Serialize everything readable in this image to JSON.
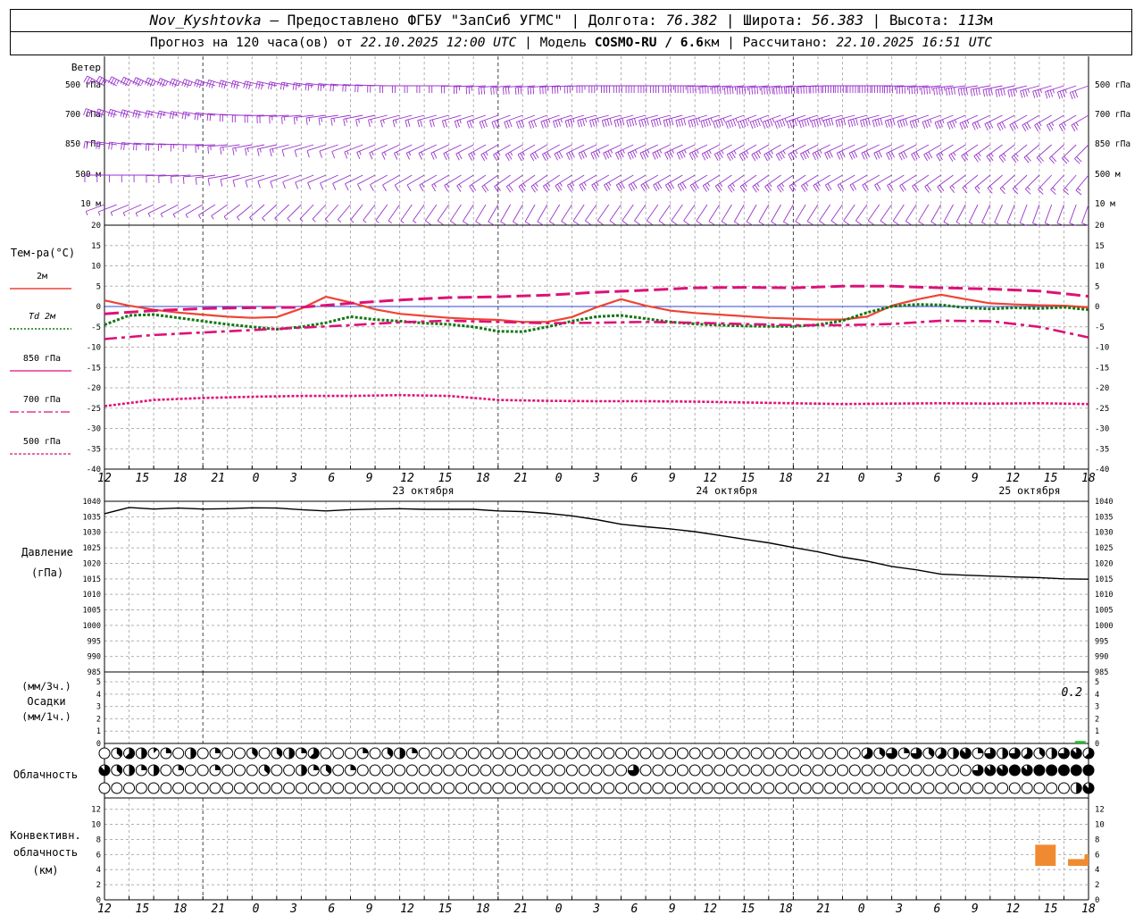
{
  "header": {
    "station": "Nov_Kyshtovka",
    "provider": "Предоставлено ФГБУ \"ЗапСиб УГМС\"",
    "lon_label": "Долгота:",
    "lon": "76.382",
    "lat_label": "Широта:",
    "lat": "56.383",
    "alt_label": "Высота:",
    "alt": "113",
    "alt_unit": "м",
    "forecast_label": "Прогноз на 120 часа(ов) от",
    "forecast_start": "22.10.2025 12:00 UTC",
    "model_label": "Модель",
    "model": "COSMO-RU / 6.6",
    "model_unit": "км",
    "calc_label": "Рассчитано:",
    "calc_time": "22.10.2025 16:51 UTC"
  },
  "colors": {
    "wind": "#9933cc",
    "temp2m": "#ee4433",
    "td2m": "#117711",
    "t850": "#dd1177",
    "t700": "#dd1177",
    "t500": "#dd1177",
    "pressure": "#000000",
    "precip": "#22bb33",
    "convective": "#f08a30",
    "grid": "#b0b0b0",
    "zero_line": "#3344cc"
  },
  "wind_panel": {
    "title": "Ветер",
    "levels": [
      "500 гПа",
      "700 гПа",
      "850 гПа",
      "500 м",
      "10  м"
    ]
  },
  "temp_panel": {
    "title": "Тем-ра(°C)",
    "legend": [
      "2м",
      "Td  2м",
      "850 гПа",
      "700 гПа",
      "500 гПа"
    ],
    "ticks": [
      "20",
      "15",
      "10",
      "5",
      "0",
      "-5",
      "-10",
      "-15",
      "-20",
      "-25",
      "-30",
      "-35",
      "-40"
    ]
  },
  "time_axis": {
    "hour_labels": [
      "12",
      "15",
      "18",
      "21",
      "0",
      "3",
      "6",
      "9",
      "12",
      "15",
      "18",
      "21",
      "0",
      "3",
      "6",
      "9",
      "12",
      "15",
      "18",
      "21",
      "0",
      "3",
      "6",
      "9",
      "12",
      "15",
      "18"
    ],
    "date_labels": [
      "23 октября",
      "24 октября",
      "25 октября"
    ]
  },
  "pressure_panel": {
    "title": "Давление",
    "unit": "(гПа)",
    "ticks": [
      "1040",
      "1035",
      "1030",
      "1025",
      "1020",
      "1015",
      "1010",
      "1005",
      "1000",
      "995",
      "990",
      "985"
    ]
  },
  "precip_panel": {
    "unit_top": "(мм/3ч.)",
    "title": "Осадки",
    "unit_bottom": "(мм/1ч.)",
    "ticks": [
      "5",
      "4",
      "3",
      "2",
      "1",
      "0"
    ],
    "annotation": "0.2"
  },
  "cloud_panel": {
    "title": "Облачность"
  },
  "conv_panel": {
    "title_1": "Конвективн.",
    "title_2": "облачность",
    "unit": "(км)",
    "ticks": [
      "12",
      "10",
      "8",
      "6",
      "4",
      "2",
      "0"
    ]
  },
  "chart_data": [
    {
      "type": "wind_barbs",
      "x_unit": "hours from 22.10.2025 12:00 UTC",
      "levels": [
        "500 гПа",
        "700 гПа",
        "850 гПа",
        "500 м",
        "10 м"
      ],
      "x": [
        0,
        6,
        12,
        18,
        24,
        30,
        36,
        42,
        48,
        54,
        60,
        66,
        72,
        78,
        84,
        90,
        96,
        102,
        108,
        114,
        120
      ],
      "direction_deg": [
        [
          300,
          295,
          290,
          285,
          280,
          275,
          270,
          270,
          265,
          265,
          270,
          270,
          270,
          265,
          265,
          270,
          270,
          265,
          260,
          255,
          250
        ],
        [
          290,
          285,
          280,
          270,
          265,
          260,
          255,
          255,
          250,
          250,
          255,
          255,
          255,
          250,
          250,
          255,
          255,
          250,
          245,
          240,
          240
        ],
        [
          280,
          275,
          270,
          260,
          255,
          250,
          245,
          245,
          240,
          240,
          245,
          245,
          245,
          240,
          240,
          245,
          245,
          240,
          235,
          230,
          225
        ],
        [
          270,
          270,
          265,
          255,
          250,
          245,
          240,
          240,
          235,
          235,
          240,
          240,
          240,
          235,
          235,
          240,
          240,
          235,
          230,
          225,
          220
        ],
        [
          250,
          245,
          240,
          230,
          225,
          220,
          215,
          215,
          210,
          210,
          215,
          215,
          215,
          210,
          210,
          215,
          215,
          210,
          205,
          200,
          200
        ]
      ],
      "speed_ms": [
        [
          18,
          18,
          17,
          15,
          13,
          11,
          9,
          10,
          14,
          16,
          18,
          20,
          22,
          23,
          24,
          25,
          24,
          22,
          20,
          18,
          16
        ],
        [
          14,
          14,
          12,
          10,
          8,
          7,
          8,
          10,
          14,
          16,
          18,
          20,
          21,
          22,
          22,
          21,
          20,
          18,
          16,
          14,
          12
        ],
        [
          9,
          9,
          8,
          7,
          6,
          6,
          7,
          9,
          12,
          14,
          16,
          17,
          18,
          18,
          17,
          16,
          15,
          14,
          12,
          11,
          10
        ],
        [
          6,
          6,
          5,
          5,
          4,
          4,
          5,
          7,
          10,
          12,
          13,
          14,
          14,
          13,
          12,
          11,
          10,
          9,
          8,
          7,
          8
        ],
        [
          3,
          3,
          3,
          3,
          2,
          2,
          3,
          4,
          5,
          6,
          6,
          6,
          6,
          5,
          5,
          5,
          4,
          4,
          3,
          4,
          5
        ]
      ]
    },
    {
      "type": "line",
      "title": "Тем-ра(°C)",
      "x_unit": "hours from 22.10.2025 12:00 UTC",
      "ylim": [
        -40,
        20
      ],
      "grid": true,
      "series": [
        {
          "name": "2м",
          "x": [
            0,
            3,
            6,
            9,
            12,
            15,
            18,
            21,
            24,
            27,
            30,
            33,
            36,
            39,
            42,
            45,
            48,
            51,
            54,
            57,
            60,
            63,
            66,
            69,
            72,
            75,
            78,
            81,
            84,
            87,
            90,
            93,
            96,
            99,
            102,
            105,
            108,
            111,
            114,
            117,
            120
          ],
          "y": [
            1.5,
            0.2,
            -0.8,
            -1.5,
            -2.0,
            -2.5,
            -2.8,
            -2.6,
            -0.5,
            2.4,
            1.0,
            -0.7,
            -1.8,
            -2.3,
            -2.8,
            -3.1,
            -3.3,
            -3.8,
            -3.8,
            -2.6,
            -0.2,
            1.8,
            0.2,
            -1.0,
            -1.6,
            -2.0,
            -2.4,
            -2.8,
            -3.0,
            -3.2,
            -3.2,
            -2.5,
            0.2,
            1.7,
            2.9,
            1.8,
            0.8,
            0.5,
            0.3,
            0.2,
            -0.2
          ]
        },
        {
          "name": "Td 2м",
          "x": [
            0,
            3,
            6,
            9,
            12,
            15,
            18,
            21,
            24,
            27,
            30,
            33,
            36,
            39,
            42,
            45,
            48,
            51,
            54,
            57,
            60,
            63,
            66,
            69,
            72,
            75,
            78,
            81,
            84,
            87,
            90,
            93,
            96,
            99,
            102,
            105,
            108,
            111,
            114,
            117,
            120
          ],
          "y": [
            -4.5,
            -2.2,
            -2.0,
            -2.8,
            -3.6,
            -4.4,
            -5.0,
            -5.6,
            -5.0,
            -4.0,
            -2.5,
            -3.2,
            -3.6,
            -4.1,
            -4.4,
            -5.0,
            -6.1,
            -6.2,
            -5.0,
            -3.6,
            -2.5,
            -2.2,
            -3.0,
            -3.8,
            -4.3,
            -4.6,
            -4.8,
            -4.9,
            -4.9,
            -4.5,
            -3.5,
            -1.5,
            0.0,
            0.5,
            0.4,
            -0.3,
            -0.6,
            -0.3,
            -0.5,
            -0.2,
            -0.8
          ]
        },
        {
          "name": "850 гПа",
          "x": [
            0,
            6,
            12,
            18,
            24,
            30,
            36,
            42,
            48,
            54,
            60,
            66,
            72,
            78,
            84,
            90,
            96,
            102,
            108,
            114,
            120
          ],
          "y": [
            -1.8,
            -1.0,
            -0.5,
            -0.3,
            -0.2,
            0.8,
            1.6,
            2.2,
            2.4,
            2.8,
            3.5,
            4.0,
            4.6,
            4.7,
            4.6,
            5.0,
            5.0,
            4.6,
            4.3,
            3.8,
            2.5
          ]
        },
        {
          "name": "700 гПа",
          "x": [
            0,
            6,
            12,
            18,
            24,
            30,
            36,
            42,
            48,
            54,
            60,
            66,
            72,
            78,
            84,
            90,
            96,
            102,
            108,
            114,
            120
          ],
          "y": [
            -8.0,
            -7.0,
            -6.4,
            -5.8,
            -5.2,
            -4.6,
            -3.9,
            -3.5,
            -3.8,
            -4.1,
            -4.0,
            -3.8,
            -4.0,
            -4.3,
            -4.6,
            -4.6,
            -4.3,
            -3.5,
            -3.6,
            -5.0,
            -7.6
          ]
        },
        {
          "name": "500 гПа",
          "x": [
            0,
            6,
            12,
            18,
            24,
            30,
            36,
            42,
            48,
            54,
            60,
            66,
            72,
            78,
            84,
            90,
            96,
            102,
            108,
            114,
            120
          ],
          "y": [
            -24.5,
            -23.0,
            -22.5,
            -22.2,
            -22.0,
            -22.0,
            -21.8,
            -22.0,
            -23.0,
            -23.2,
            -23.3,
            -23.3,
            -23.4,
            -23.6,
            -23.8,
            -24.0,
            -23.9,
            -23.8,
            -23.9,
            -23.8,
            -24.0
          ]
        }
      ]
    },
    {
      "type": "line",
      "title": "Давление",
      "ylabel": "(гПа)",
      "x_unit": "hours from 22.10.2025 12:00 UTC",
      "ylim": [
        985,
        1040
      ],
      "grid": true,
      "series": [
        {
          "x": [
            0,
            3,
            6,
            9,
            12,
            15,
            18,
            21,
            24,
            27,
            30,
            33,
            36,
            39,
            42,
            45,
            48,
            51,
            54,
            57,
            60,
            63,
            66,
            69,
            72,
            75,
            78,
            81,
            84,
            87,
            90,
            93,
            96,
            99,
            102,
            105,
            108,
            111,
            114,
            117,
            120
          ],
          "y": [
            1036,
            1038,
            1037.5,
            1037.8,
            1037.5,
            1037.6,
            1037.9,
            1037.8,
            1037.3,
            1036.9,
            1037.3,
            1037.5,
            1037.6,
            1037.4,
            1037.4,
            1037.4,
            1036.9,
            1036.7,
            1036.1,
            1035.3,
            1034.1,
            1032.6,
            1031.8,
            1031.1,
            1030.2,
            1029.0,
            1027.8,
            1026.6,
            1025.1,
            1023.7,
            1022.0,
            1020.7,
            1019.0,
            1017.9,
            1016.5,
            1016.2,
            1015.9,
            1015.6,
            1015.4,
            1015.0,
            1014.9
          ]
        }
      ]
    },
    {
      "type": "bar",
      "title": "Осадки",
      "ylabel": "(мм/3ч.)",
      "ylim": [
        0,
        5
      ],
      "x": [
        119
      ],
      "values": [
        0.2
      ]
    },
    {
      "type": "cloud_cover",
      "title": "Облачность",
      "x_unit": "hours from 22.10.2025 12:00 UTC",
      "x": [
        0,
        1.5,
        3,
        4.5,
        6,
        7.5,
        9,
        10.5,
        12,
        13.5,
        15,
        16.5,
        18,
        19.5,
        21,
        22.5,
        24,
        25.5,
        27,
        28.5,
        30,
        31.5,
        33,
        34.5,
        36,
        37.5,
        39,
        40.5,
        42,
        43.5,
        45,
        46.5,
        48,
        49.5,
        51,
        52.5,
        54,
        55.5,
        57,
        58.5,
        60,
        61.5,
        63,
        64.5,
        66,
        67.5,
        69,
        70.5,
        72,
        73.5,
        75,
        76.5,
        78,
        79.5,
        81,
        82.5,
        84,
        85.5,
        87,
        88.5,
        90,
        91.5,
        93,
        94.5,
        96,
        97.5,
        99,
        100.5,
        102,
        103.5,
        105,
        106.5,
        108,
        109.5,
        111,
        112.5,
        114,
        115.5,
        117,
        118.5,
        120
      ],
      "rows_octas": [
        [
          0,
          3,
          5,
          4,
          1,
          2,
          0,
          4,
          0,
          2,
          0,
          0,
          3,
          0,
          3,
          4,
          2,
          5,
          0,
          0,
          0,
          2,
          0,
          3,
          4,
          2,
          0,
          0,
          0,
          0,
          0,
          0,
          0,
          0,
          0,
          0,
          0,
          0,
          0,
          0,
          0,
          0,
          0,
          0,
          0,
          0,
          0,
          0,
          0,
          0,
          0,
          0,
          0,
          0,
          0,
          0,
          0,
          0,
          0,
          0,
          0,
          0,
          5,
          3,
          6,
          2,
          6,
          3,
          5,
          4,
          7,
          2,
          6,
          4,
          6,
          5,
          3,
          4,
          6,
          7,
          5
        ],
        [
          7,
          3,
          4,
          2,
          4,
          0,
          2,
          0,
          0,
          2,
          0,
          0,
          0,
          3,
          0,
          0,
          4,
          2,
          3,
          0,
          2,
          0,
          0,
          0,
          0,
          0,
          0,
          0,
          0,
          0,
          0,
          0,
          0,
          0,
          0,
          0,
          0,
          0,
          0,
          0,
          0,
          0,
          0,
          6,
          0,
          0,
          0,
          0,
          0,
          0,
          0,
          0,
          0,
          0,
          0,
          0,
          0,
          0,
          0,
          0,
          0,
          0,
          0,
          0,
          0,
          0,
          0,
          0,
          0,
          0,
          0,
          6,
          7,
          7,
          8,
          7,
          8,
          8,
          8,
          8,
          8
        ],
        [
          0,
          0,
          0,
          0,
          0,
          0,
          0,
          0,
          0,
          0,
          0,
          0,
          0,
          0,
          0,
          0,
          0,
          0,
          0,
          0,
          0,
          0,
          0,
          0,
          0,
          0,
          0,
          0,
          0,
          0,
          0,
          0,
          0,
          0,
          0,
          0,
          0,
          0,
          0,
          0,
          0,
          0,
          0,
          0,
          0,
          0,
          0,
          0,
          0,
          0,
          0,
          0,
          0,
          0,
          0,
          0,
          0,
          0,
          0,
          0,
          0,
          0,
          0,
          0,
          0,
          0,
          0,
          0,
          0,
          0,
          0,
          0,
          0,
          0,
          0,
          0,
          0,
          0,
          0,
          4,
          7
        ]
      ]
    },
    {
      "type": "bar",
      "title": "Конвективн. облачность",
      "ylabel": "(км)",
      "ylim": [
        0,
        12
      ],
      "bars": [
        {
          "x0": 113.5,
          "x1": 116.0,
          "base": 4.5,
          "top": 7.3
        },
        {
          "x0": 117.5,
          "x1": 120.0,
          "base": 4.5,
          "top": 5.4
        },
        {
          "x0": 119.5,
          "x1": 120.0,
          "base": 4.5,
          "top": 6.0
        }
      ]
    }
  ]
}
